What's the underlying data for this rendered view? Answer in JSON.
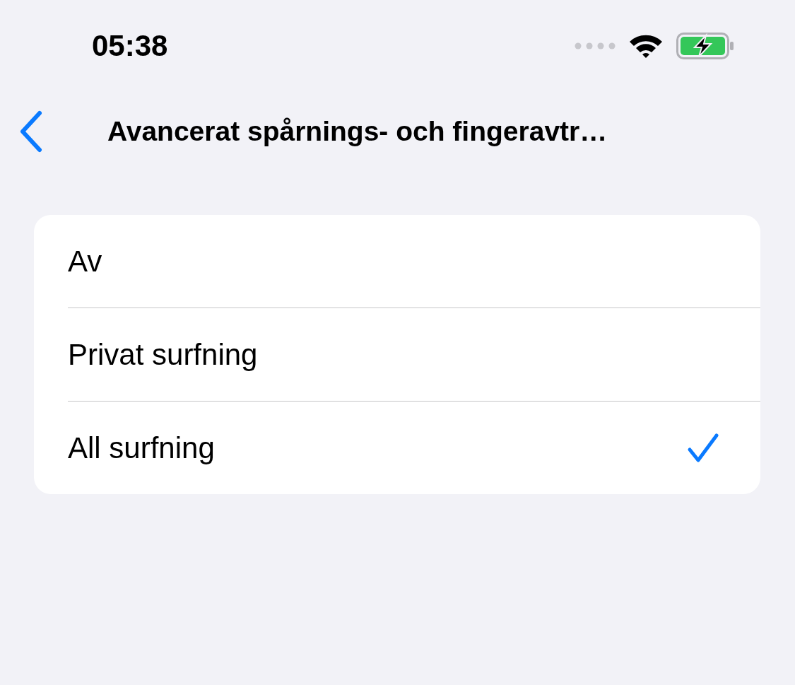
{
  "status_bar": {
    "time": "05:38"
  },
  "nav": {
    "title": "Avancerat spårnings- och fingeravtr…"
  },
  "options": [
    {
      "label": "Av",
      "selected": false
    },
    {
      "label": "Privat surfning",
      "selected": false
    },
    {
      "label": "All surfning",
      "selected": true
    }
  ]
}
